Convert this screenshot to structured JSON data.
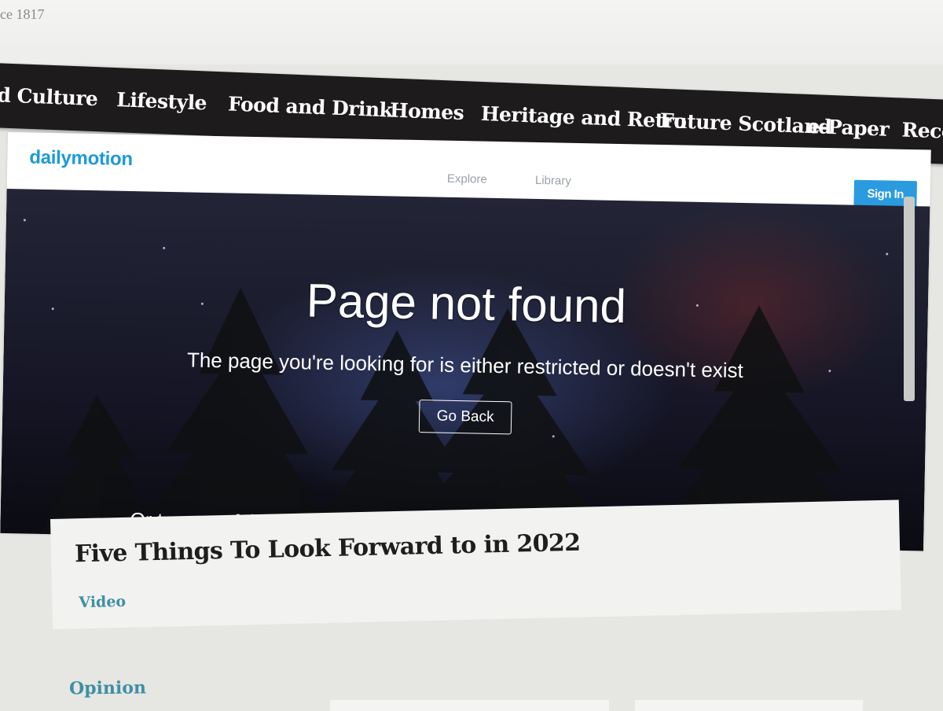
{
  "site": {
    "since_text": "ce 1817"
  },
  "nav": {
    "items": [
      {
        "label": "d Culture"
      },
      {
        "label": "Lifestyle"
      },
      {
        "label": "Food and Drink"
      },
      {
        "label": "Homes"
      },
      {
        "label": "Heritage and Retro"
      },
      {
        "label": "Future Scotland"
      },
      {
        "label": "e-Paper"
      },
      {
        "label": "Reco"
      }
    ]
  },
  "dailymotion": {
    "logo": "dailymotion",
    "nav": {
      "explore": "Explore",
      "library": "Library"
    },
    "signin_label": "Sign In",
    "error": {
      "title": "Page not found",
      "message": "The page you're looking for is either restricted or doesn't exist",
      "go_back_label": "Go Back",
      "suggestion": "Or try one of these videos..."
    }
  },
  "article": {
    "title": "Five Things To Look Forward to in 2022",
    "tag": "Video"
  },
  "sections": {
    "opinion": "Opinion"
  },
  "colors": {
    "nav_bg": "#1d1b1c",
    "dm_brand": "#1b9ad8",
    "signin_bg": "#2b9be0",
    "tag_color": "#3f8fa3"
  }
}
